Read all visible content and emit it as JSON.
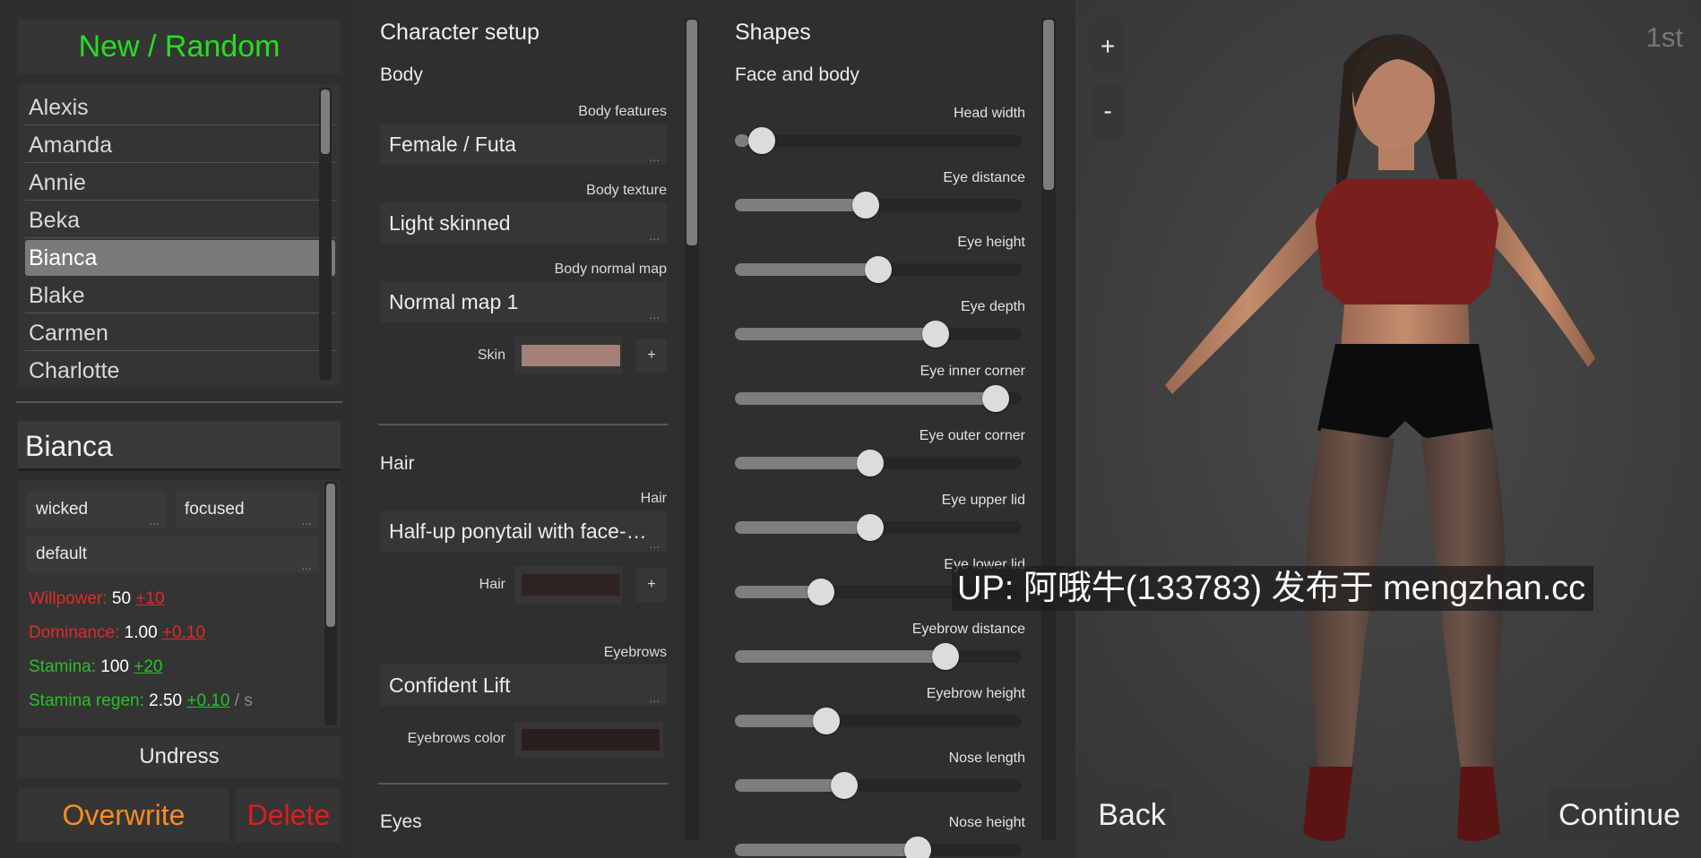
{
  "left": {
    "new_random": "New / Random",
    "characters": [
      "Alexis",
      "Amanda",
      "Annie",
      "Beka",
      "Bianca",
      "Blake",
      "Carmen",
      "Charlotte"
    ],
    "selected_index": 4,
    "current_name": "Bianca",
    "traits": [
      "wicked",
      "focused",
      "default"
    ],
    "stats": [
      {
        "label": "Willpower:",
        "value": "50",
        "bonus": "+10",
        "unit": "",
        "color": "red"
      },
      {
        "label": "Dominance:",
        "value": "1.00",
        "bonus": "+0.10",
        "unit": "",
        "color": "red"
      },
      {
        "label": "Stamina:",
        "value": "100",
        "bonus": "+20",
        "unit": "",
        "color": "green"
      },
      {
        "label": "Stamina regen:",
        "value": "2.50",
        "bonus": "+0.10",
        "unit": "/ s",
        "color": "green"
      }
    ],
    "undress": "Undress",
    "overwrite": "Overwrite",
    "delete": "Delete"
  },
  "setup": {
    "title": "Character setup",
    "body_title": "Body",
    "body_features_label": "Body features",
    "body_features_value": "Female / Futa",
    "body_texture_label": "Body texture",
    "body_texture_value": "Light skinned",
    "body_normal_label": "Body normal map",
    "body_normal_value": "Normal map 1",
    "skin_label": "Skin",
    "skin_color": "#a38078",
    "plus": "+",
    "hair_title": "Hair",
    "hair_label": "Hair",
    "hair_value": "Half-up ponytail with face-…",
    "hair_color_label": "Hair",
    "hair_color": "#2e2222",
    "eyebrows_label": "Eyebrows",
    "eyebrows_value": "Confident Lift",
    "eyebrows_color_label": "Eyebrows color",
    "eyebrows_color": "#2a1e1e",
    "eyes_title": "Eyes",
    "dots": "..."
  },
  "shapes": {
    "title": "Shapes",
    "subtitle": "Face and body",
    "sliders": [
      {
        "label": "Head width",
        "value": 0.05
      },
      {
        "label": "Eye distance",
        "value": 0.45
      },
      {
        "label": "Eye height",
        "value": 0.5
      },
      {
        "label": "Eye depth",
        "value": 0.72
      },
      {
        "label": "Eye inner corner",
        "value": 0.95
      },
      {
        "label": "Eye outer corner",
        "value": 0.47
      },
      {
        "label": "Eye upper lid",
        "value": 0.47
      },
      {
        "label": "Eye lower lid",
        "value": 0.28
      },
      {
        "label": "Eyebrow distance",
        "value": 0.76
      },
      {
        "label": "Eyebrow height",
        "value": 0.3
      },
      {
        "label": "Nose length",
        "value": 0.37
      },
      {
        "label": "Nose height",
        "value": 0.65
      }
    ]
  },
  "viewport": {
    "zoom_in": "+",
    "zoom_out": "-",
    "view_mode": "1st",
    "back": "Back",
    "continue": "Continue",
    "watermark": "UP: 阿哦牛(133783) 发布于 mengzhan.cc"
  },
  "colors": {
    "accent_green": "#22e022",
    "accent_orange": "#ff8a1e",
    "accent_red": "#e21d1d",
    "stat_red": "#e02a2a",
    "stat_green": "#2cbf2c"
  }
}
